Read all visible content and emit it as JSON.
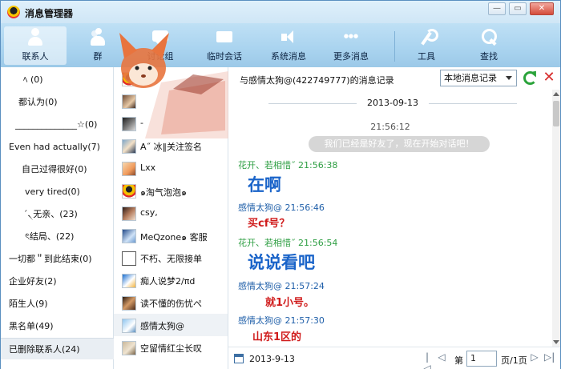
{
  "app": {
    "title": "消息管理器"
  },
  "window_buttons": {
    "minimize": "—",
    "maximize": "▭",
    "close": "✕"
  },
  "toolbar": [
    {
      "label": "联系人",
      "icon": "person-icon",
      "active": true
    },
    {
      "label": "群",
      "icon": "group-icon",
      "active": false
    },
    {
      "label": "讨论组",
      "icon": "discussion-icon",
      "active": false
    },
    {
      "label": "临时会话",
      "icon": "temp-chat-icon",
      "active": false
    },
    {
      "label": "系统消息",
      "icon": "system-message-icon",
      "active": false
    },
    {
      "label": "更多消息",
      "icon": "more-icon",
      "active": false
    },
    {
      "label": "工具",
      "icon": "wrench-icon",
      "active": false
    },
    {
      "label": "查找",
      "icon": "search-icon",
      "active": false
    }
  ],
  "groups": [
    {
      "label": "ﾍ            (0)"
    },
    {
      "label": "都认为(0)"
    },
    {
      "label": "______________☆(0)"
    },
    {
      "label": "Even had actually(7)"
    },
    {
      "label": "自己过得很好(0)"
    },
    {
      "label": "very tired(0)"
    },
    {
      "label": "ˊ৲无亲、(23)"
    },
    {
      "label": "ৎ结局、(22)"
    },
    {
      "label": "一切都＂到此结束(0)"
    },
    {
      "label": "企业好友(2)"
    },
    {
      "label": "陌生人(9)"
    },
    {
      "label": "黑名单(49)"
    },
    {
      "label": "已删除联系人(24)"
    }
  ],
  "contacts": [
    {
      "name": ""
    },
    {
      "name": ""
    },
    {
      "name": "-"
    },
    {
      "name": "A˝ 冰‖关注签名"
    },
    {
      "name": "Lxx"
    },
    {
      "name": "๑淘气泡泡๑"
    },
    {
      "name": "csy,"
    },
    {
      "name": "MeQzone๑   客服"
    },
    {
      "name": "不朽、无限接单"
    },
    {
      "name": "痴人说梦2/πd"
    },
    {
      "name": "读不懂的伤忧ぺ"
    },
    {
      "name": "感情太狗@"
    },
    {
      "name": "空留情红尘长叹"
    }
  ],
  "right_header": {
    "title": "与感情太狗@(422749777)的消息记录",
    "dropdown_value": "本地消息记录"
  },
  "log": {
    "date": "2013-09-13",
    "system_time": "21:56:12",
    "system_message": "我们已经是好友了，现在开始对话吧！",
    "messages": [
      {
        "sender": "花开、若相惜˝    21:56:38",
        "text": "在啊"
      },
      {
        "sender": "感情太狗@ 21:56:46",
        "text": "买cf号？"
      },
      {
        "sender": "花开、若相惜˝    21:56:54",
        "text": "说说看吧"
      },
      {
        "sender": "感情太狗@ 21:57:24",
        "text": "就1小号。"
      },
      {
        "sender": "感情太狗@ 21:57:30",
        "text": "山东1区的"
      }
    ]
  },
  "footer": {
    "date": "2013-9-13",
    "page_prefix": "第",
    "page_value": "1",
    "page_suffix": "页/1页",
    "first": "|◁",
    "prev": "◁",
    "next": "▷",
    "last": "▷|"
  },
  "colors": {
    "toolbar": "#a9d3ef",
    "friend_sender": "#2d9e42",
    "me_sender": "#1f5fa9",
    "blue_text": "#1a64c9",
    "red_text": "#d01c1c"
  }
}
